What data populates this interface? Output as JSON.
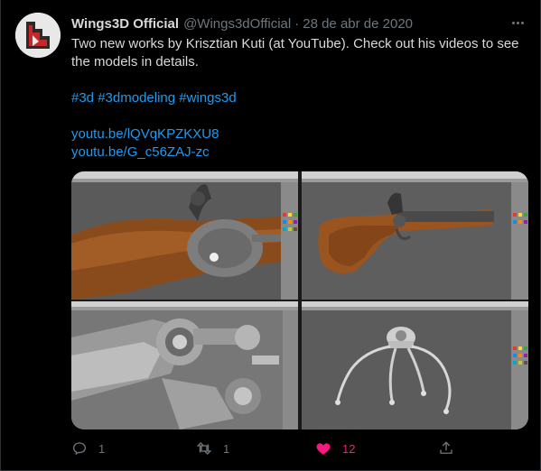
{
  "tweet": {
    "author_name": "Wings3D Official",
    "handle": "@Wings3dOfficial",
    "separator": "·",
    "date": "28 de abr de 2020",
    "text_line": "Two new works by Krisztian Kuti (at YouTube). Check out his videos to see the models in details.",
    "hashtags": [
      "#3d",
      "#3dmodeling",
      "#wings3d"
    ],
    "links": [
      "youtu.be/lQVqKPZKXU8",
      "youtu.be/G_c56ZAJ-zc"
    ]
  },
  "media": [
    {
      "subject": "flintlock-pistol-closeup"
    },
    {
      "subject": "flintlock-pistol-full"
    },
    {
      "subject": "mechanical-robot-closeup"
    },
    {
      "subject": "mechanical-spider-walker"
    }
  ],
  "actions": {
    "reply_count": "1",
    "retweet_count": "1",
    "like_count": "12",
    "share_count": ""
  },
  "colors": {
    "background": "#000000",
    "text": "#d9d9d9",
    "muted": "#6e767d",
    "link": "#1d9bf0",
    "like": "#f91880"
  }
}
